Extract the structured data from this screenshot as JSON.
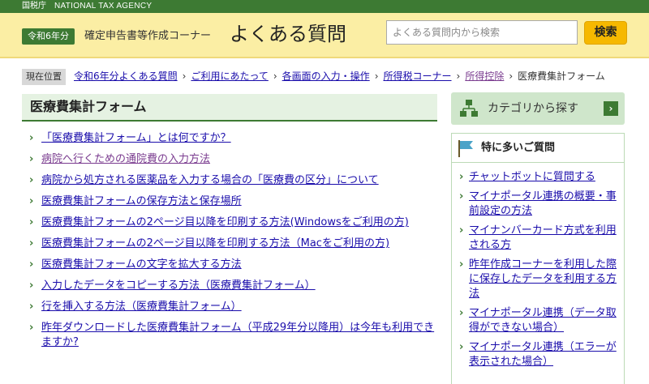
{
  "agency": {
    "jp": "国税庁",
    "en": "NATIONAL TAX AGENCY"
  },
  "header": {
    "year_badge": "令和6年分",
    "corner_title": "確定申告書等作成コーナー",
    "faq_title": "よくある質問",
    "search_placeholder": "よくある質問内から検索",
    "search_button": "検索"
  },
  "breadcrumb": {
    "label": "現在位置",
    "items": [
      {
        "text": "令和6年分よくある質問"
      },
      {
        "text": "ご利用にあたって"
      },
      {
        "text": "各画面の入力・操作"
      },
      {
        "text": "所得税コーナー"
      },
      {
        "text": "所得控除"
      }
    ],
    "current": "医療費集計フォーム"
  },
  "main": {
    "title": "医療費集計フォーム",
    "questions": [
      {
        "text": "「医療費集計フォーム」とは何ですか？"
      },
      {
        "text": "病院へ行くための通院費の入力方法"
      },
      {
        "text": "病院から処方される医薬品を入力する場合の「医療費の区分」について"
      },
      {
        "text": "医療費集計フォームの保存方法と保存場所"
      },
      {
        "text": "医療費集計フォームの2ページ目以降を印刷する方法(Windowsをご利用の方)"
      },
      {
        "text": "医療費集計フォームの2ページ目以降を印刷する方法（Macをご利用の方)"
      },
      {
        "text": "医療費集計フォームの文字を拡大する方法"
      },
      {
        "text": "入力したデータをコピーする方法（医療費集計フォーム）"
      },
      {
        "text": "行を挿入する方法（医療費集計フォーム）"
      },
      {
        "text": "昨年ダウンロードした医療費集計フォーム（平成29年分以降用）は今年も利用できますか?"
      }
    ]
  },
  "sidebar": {
    "category_button": "カテゴリから探す",
    "popular_title": "特に多いご質問",
    "popular": [
      {
        "text": "チャットボットに質問する"
      },
      {
        "text": "マイナポータル連携の概要・事前設定の方法"
      },
      {
        "text": "マイナンバーカード方式を利用される方"
      },
      {
        "text": "昨年作成コーナーを利用した際に保存したデータを利用する方法"
      },
      {
        "text": "マイナポータル連携（データ取得ができない場合）"
      },
      {
        "text": "マイナポータル連携（エラーが表示された場合）"
      }
    ]
  },
  "icons": {
    "category": "grid-boxes-icon",
    "popular": "flag-icon",
    "bullet": "chevron-right-icon",
    "arrow": "arrow-right-icon"
  },
  "colors": {
    "brand_green": "#3d7a33",
    "header_yellow": "#fbeea4",
    "search_button": "#f6b800",
    "link": "#1a0dab",
    "visited_link": "#7a3b8f"
  }
}
